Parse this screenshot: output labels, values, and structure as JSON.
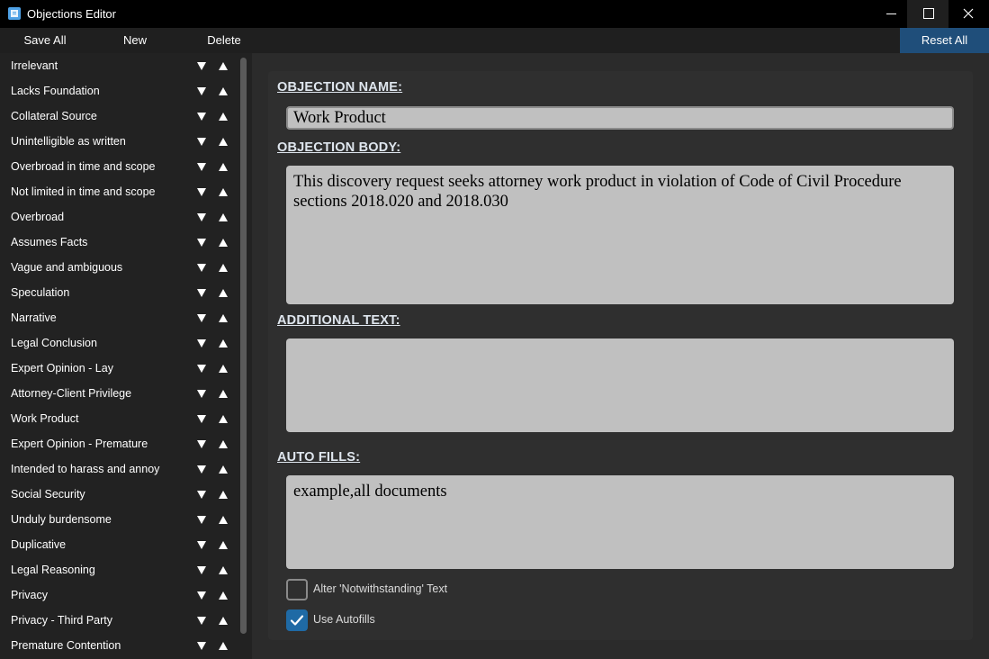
{
  "window": {
    "title": "Objections Editor",
    "icons": {
      "app": "app-icon",
      "minimize": "minimize-icon",
      "maximize": "maximize-icon",
      "close": "close-icon"
    }
  },
  "toolbar": {
    "save_all": "Save All",
    "new": "New",
    "delete": "Delete",
    "reset_all": "Reset All"
  },
  "objections": [
    "Irrelevant",
    "Lacks Foundation",
    "Collateral Source",
    "Unintelligible as written",
    "Overbroad in time and scope",
    "Not limited in time and scope",
    "Overbroad",
    "Assumes Facts",
    "Vague and ambiguous",
    "Speculation",
    "Narrative",
    "Legal Conclusion",
    "Expert Opinion - Lay",
    "Attorney-Client Privilege",
    "Work Product",
    "Expert Opinion - Premature",
    "Intended to harass and annoy",
    "Social Security",
    "Unduly burdensome",
    "Duplicative",
    "Legal Reasoning",
    "Privacy",
    "Privacy - Third Party",
    "Premature Contention"
  ],
  "editor": {
    "name_label": "OBJECTION NAME:",
    "name_value": "Work Product",
    "body_label": "OBJECTION BODY:",
    "body_value": "This discovery request seeks attorney work product in violation of Code of Civil Procedure sections 2018.020 and 2018.030",
    "additional_label": "ADDITIONAL TEXT:",
    "additional_value": "",
    "autofills_label": "AUTO FILLS:",
    "autofills_value": "example,all documents",
    "alter_label": "Alter 'Notwithstanding' Text",
    "alter_checked": false,
    "use_autofills_label": "Use Autofills",
    "use_autofills_checked": true
  },
  "colors": {
    "accent": "#1f6aa5",
    "reset_button": "#1f4e7a",
    "field_bg": "#c0c0c0",
    "panel_bg": "#2f2f2f",
    "sidebar_bg": "#222222"
  }
}
